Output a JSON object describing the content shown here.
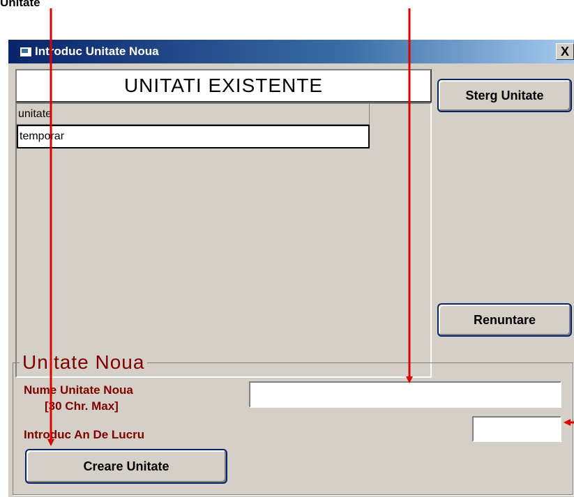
{
  "annotation_label": "Unitate",
  "window": {
    "title": "Introduc Unitate Noua",
    "close_label": "X"
  },
  "list": {
    "header": "UNITATI EXISTENTE",
    "column_header": "unitate",
    "rows": [
      "temporar"
    ]
  },
  "buttons": {
    "delete": "Sterg Unitate",
    "cancel": "Renuntare",
    "create": "Creare Unitate"
  },
  "new_unit": {
    "group_title": "Unitate Noua",
    "name_label": "Nume Unitate Noua",
    "name_hint": "[30 Chr. Max]",
    "year_label": "Introduc An De Lucru",
    "name_value": "",
    "year_value": ""
  },
  "colors": {
    "annotation_arrow": "#e00000",
    "label_text": "#800000",
    "titlebar": "#0a246a"
  }
}
